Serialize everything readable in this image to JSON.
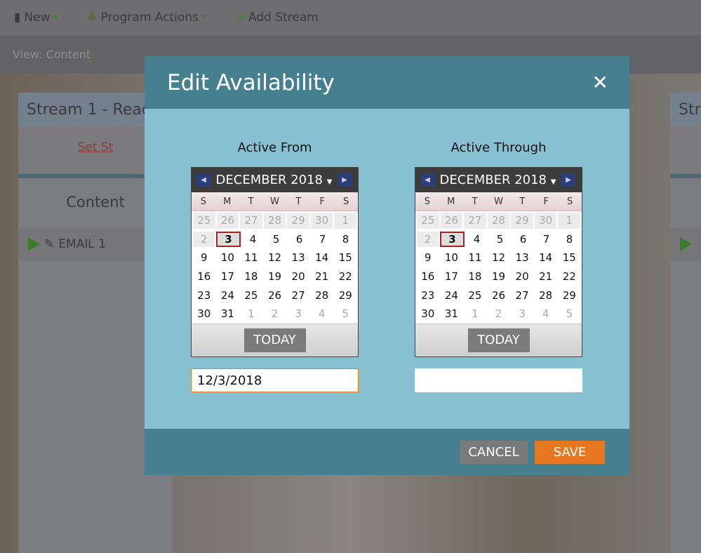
{
  "toolbar": {
    "new": "New",
    "program_actions": "Program Actions",
    "add_stream": "Add Stream"
  },
  "viewbar": {
    "label": "View: Content"
  },
  "background": {
    "stream_title": "Stream 1 - Read",
    "set_link": "Set St",
    "content_label": "Content",
    "email_item": "EMAIL 1",
    "right_stream_title": "Str"
  },
  "modal": {
    "title": "Edit Availability",
    "day_names": [
      "S",
      "M",
      "T",
      "W",
      "T",
      "F",
      "S"
    ],
    "weeks": [
      [
        25,
        26,
        27,
        28,
        29,
        30,
        1
      ],
      [
        2,
        3,
        4,
        5,
        6,
        7,
        8
      ],
      [
        9,
        10,
        11,
        12,
        13,
        14,
        15
      ],
      [
        16,
        17,
        18,
        19,
        20,
        21,
        22
      ],
      [
        23,
        24,
        25,
        26,
        27,
        28,
        29
      ],
      [
        30,
        31,
        1,
        2,
        3,
        4,
        5
      ]
    ],
    "today": 3,
    "from": {
      "label": "Active From",
      "month": "DECEMBER 2018",
      "today_label": "TODAY",
      "value": "12/3/2018"
    },
    "through": {
      "label": "Active Through",
      "month": "DECEMBER 2018",
      "today_label": "TODAY",
      "value": ""
    },
    "cancel": "CANCEL",
    "save": "SAVE"
  },
  "colors": {
    "header": "#46808f",
    "body": "#87c0d1",
    "save": "#e87722",
    "cancel": "#7a7a7a"
  }
}
